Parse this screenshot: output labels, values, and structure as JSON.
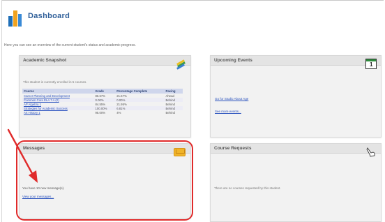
{
  "page": {
    "title": "Dashboard",
    "intro": "Here you can see an overview of the current student's status and academic progress."
  },
  "snapshot": {
    "title": "Academic Snapshot",
    "enrolled_text": "This student is currently enrolled in 5 courses.",
    "columns": [
      "Course",
      "Grade",
      "Percentage Complete",
      "Pacing"
    ],
    "rows": [
      [
        "Career Planning and Development",
        "86.67%",
        "21.67%",
        "Ahead"
      ],
      [
        "Common Core ELA 7 A (2)",
        "0.00%",
        "0.00%",
        "Behind"
      ],
      [
        "AP Algebra 1",
        "84.55%",
        "21.95%",
        "Behind"
      ],
      [
        "Strategies for Academic Success",
        "100.00%",
        "6.81%",
        "Behind"
      ],
      [
        "Art History 1",
        "95.00%",
        "4%",
        "Behind"
      ]
    ]
  },
  "events": {
    "title": "Upcoming Events",
    "event_link": "Go for Studio About Age",
    "more_link": "See more events..."
  },
  "messages": {
    "title": "Messages",
    "unread_text": "You have 10 new message(s).",
    "view_link": "View your messages..."
  },
  "requests": {
    "title": "Course Requests",
    "empty_text": "There are no courses requested by this student."
  },
  "colors": {
    "highlight": "#e02b2b",
    "link": "#2a52be",
    "title": "#2f5f99"
  }
}
